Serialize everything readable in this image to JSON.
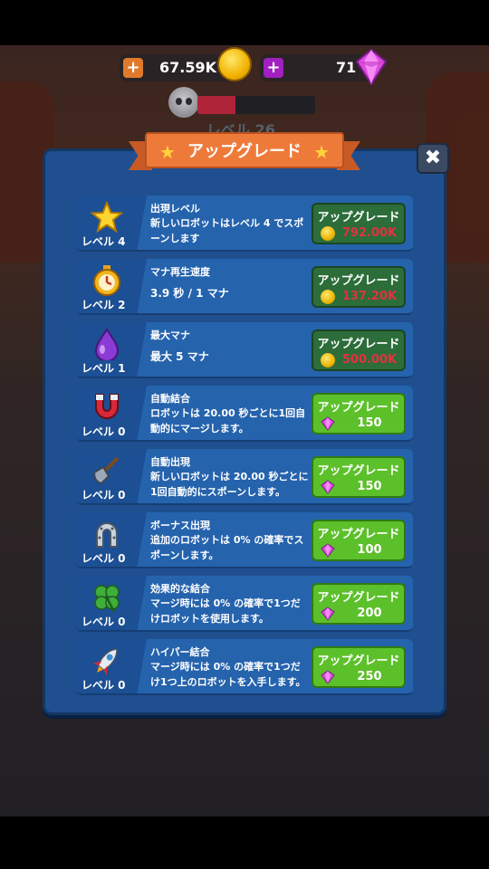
{
  "colors": {
    "panel": "#1f4f8f",
    "row": "#2563ad",
    "ribbon": "#ee7a3a",
    "button_green": "#5cc02a",
    "button_dark": "#2c6d3a",
    "price_red": "#e5313f",
    "gem": "#d64ad6",
    "gold": "#f2b200"
  },
  "resources": {
    "gold": {
      "value": "67.59K",
      "add_icon": "plus-icon",
      "icon": "gold-coin-icon"
    },
    "gems": {
      "value": "71",
      "add_icon": "plus-icon",
      "icon": "gem-icon"
    }
  },
  "boss": {
    "icon": "skull-icon",
    "progress": 0.32,
    "level_label": "レベル 26"
  },
  "dialog": {
    "title": "アップグレード",
    "title_icons": [
      "star-icon",
      "star-icon"
    ],
    "close_icon": "close-icon",
    "upgrades": [
      {
        "icon": "star-icon",
        "level": "レベル 4",
        "title": "出現レベル",
        "desc": "新しいロボットはレベル 4 でスポーンします",
        "button_label": "アップグレード",
        "currency": "gold",
        "price": "792.00K",
        "affordable": false
      },
      {
        "icon": "stopwatch-icon",
        "level": "レベル 2",
        "title": "マナ再生速度",
        "desc": "3.9 秒 / 1 マナ",
        "button_label": "アップグレード",
        "currency": "gold",
        "price": "137.20K",
        "affordable": false
      },
      {
        "icon": "mana-drop-icon",
        "level": "レベル 1",
        "title": "最大マナ",
        "desc": "最大 5 マナ",
        "button_label": "アップグレード",
        "currency": "gold",
        "price": "500.00K",
        "affordable": false
      },
      {
        "icon": "magnet-icon",
        "level": "レベル 0",
        "title": "自動結合",
        "desc": "ロボットは 20.00 秒ごとに1回自動的にマージします。",
        "button_label": "アップグレード",
        "currency": "gem",
        "price": "150",
        "affordable": true
      },
      {
        "icon": "shovel-icon",
        "level": "レベル 0",
        "title": "自動出現",
        "desc": "新しいロボットは 20.00 秒ごとに1回自動的にスポーンします。",
        "button_label": "アップグレード",
        "currency": "gem",
        "price": "150",
        "affordable": true
      },
      {
        "icon": "horseshoe-icon",
        "level": "レベル 0",
        "title": "ボーナス出現",
        "desc": "追加のロボットは 0% の確率でスポーンします。",
        "button_label": "アップグレード",
        "currency": "gem",
        "price": "100",
        "affordable": true
      },
      {
        "icon": "clover-icon",
        "level": "レベル 0",
        "title": "効果的な結合",
        "desc": "マージ時には 0% の確率で1つだけロボットを使用します。",
        "button_label": "アップグレード",
        "currency": "gem",
        "price": "200",
        "affordable": true
      },
      {
        "icon": "rocket-icon",
        "level": "レベル 0",
        "title": "ハイパー結合",
        "desc": "マージ時には 0% の確率で1つだけ1つ上のロボットを入手します。",
        "button_label": "アップグレード",
        "currency": "gem",
        "price": "250",
        "affordable": true
      }
    ]
  }
}
